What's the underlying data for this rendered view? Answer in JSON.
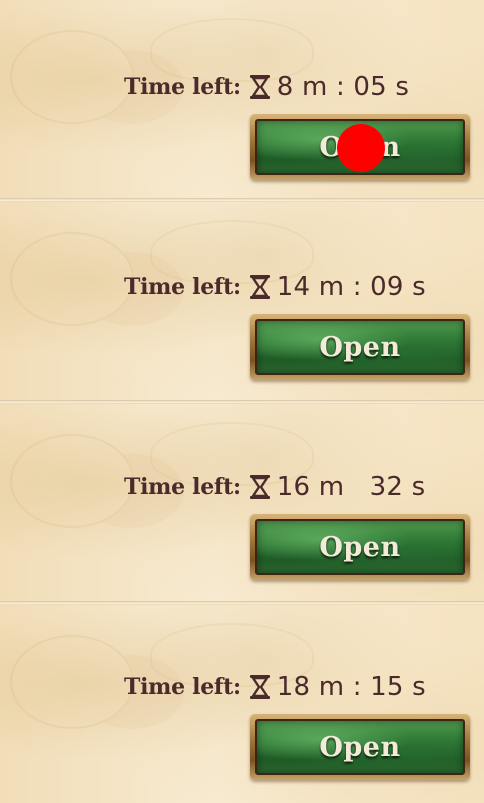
{
  "colors": {
    "text": "#4a2a2a",
    "button_green": "#2f7a36",
    "button_label": "#f3ead7",
    "marker": "#ff0000"
  },
  "icons": {
    "timer_icon": "hourglass-icon"
  },
  "rows": [
    {
      "label": "Time left:",
      "time": "8 m : 05 s",
      "button": "Open"
    },
    {
      "label": "Time left:",
      "time": "14 m : 09 s",
      "button": "Open"
    },
    {
      "label": "Time left:",
      "time": "16 m   32 s",
      "button": "Open"
    },
    {
      "label": "Time left:",
      "time": "18 m : 15 s",
      "button": "Open"
    }
  ]
}
